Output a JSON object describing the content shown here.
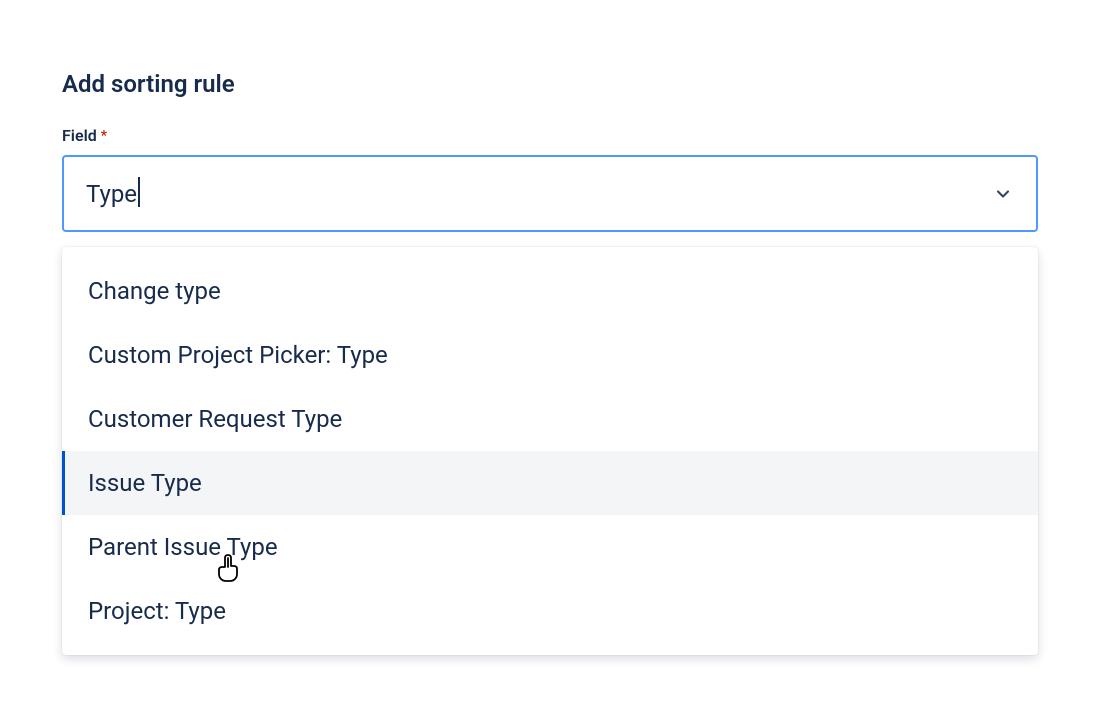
{
  "title": "Add sorting rule",
  "field": {
    "label": "Field",
    "required_marker": "*",
    "input_value": "Type"
  },
  "dropdown": {
    "options": [
      {
        "label": "Change type",
        "highlighted": false
      },
      {
        "label": "Custom Project Picker: Type",
        "highlighted": false
      },
      {
        "label": "Customer Request Type",
        "highlighted": false
      },
      {
        "label": "Issue Type",
        "highlighted": true
      },
      {
        "label": "Parent Issue Type",
        "highlighted": false
      },
      {
        "label": "Project: Type",
        "highlighted": false
      }
    ]
  }
}
